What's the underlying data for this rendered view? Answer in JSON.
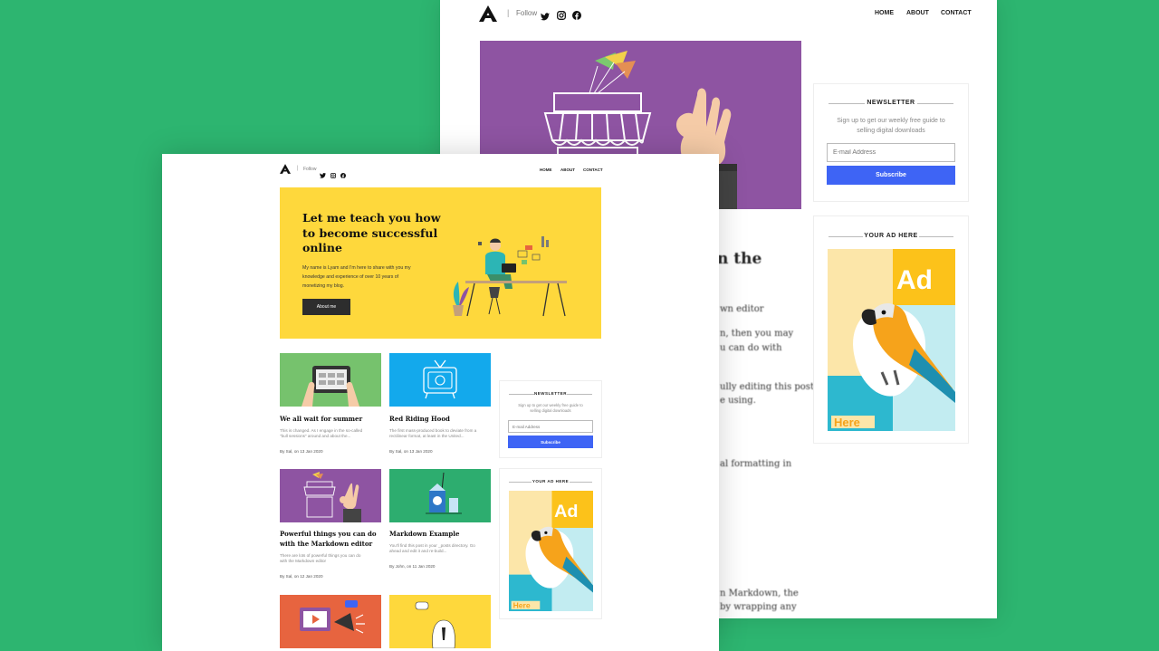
{
  "nav": {
    "follow": "Follow",
    "home": "HOME",
    "about": "ABOUT",
    "contact": "CONTACT"
  },
  "hero": {
    "title_l1": "Let me teach you how",
    "title_l2": "to become successful",
    "title_l3": "online",
    "text_l1": "My name is Lyam and I'm here to share with you my",
    "text_l2": "knowledge and experience of over 10 years of",
    "text_l3": "monetizing my blog.",
    "button": "About me"
  },
  "newsletter": {
    "title": "NEWSLETTER",
    "text_l1": "Sign up to get our weekly free guide to",
    "text_l2": "selling digital downloads",
    "placeholder": "E-mail Address",
    "button": "Subscribe"
  },
  "ad": {
    "title": "YOUR AD HERE",
    "word": "Ad",
    "here": "Here"
  },
  "posts": [
    {
      "title_l1": "We all wait for summer",
      "title_l2": "",
      "excerpt_l1": "This is changed. As I engage in the so-called",
      "excerpt_l2": "\"bull sessions\" around and about the...",
      "meta": "By Sal, on 13 Jan 2020"
    },
    {
      "title_l1": "Red Riding Hood",
      "title_l2": "",
      "excerpt_l1": "The first mass-produced book to deviate from a",
      "excerpt_l2": "rectilinear format, at least in the United...",
      "meta": "By Sal, on 13 Jan 2020"
    },
    {
      "title_l1": "Powerful things you can do",
      "title_l2": "with the Markdown editor",
      "excerpt_l1": "There are lots of powerful things you can do",
      "excerpt_l2": "with the Markdown editor",
      "meta": "By Sal, on 12 Jan 2020"
    },
    {
      "title_l1": "Markdown Example",
      "title_l2": "",
      "excerpt_l1": "You'll find this post in your _posts directory. Go",
      "excerpt_l2": "ahead and edit it and re-build...",
      "meta": "By John, on 11 Jan 2020"
    }
  ],
  "back_article": {
    "title_frag": "n the",
    "l1": "wn editor",
    "l2": "n, then you may",
    "l3": "u can do with",
    "l4": "ully editing this post",
    "l5": "e using.",
    "l6": "al formatting in",
    "l7": "n Markdown, the",
    "l8": "by wrapping any"
  },
  "colors": {
    "background": "#2db570",
    "hero": "#fed83c",
    "purple": "#8e54a2",
    "subscribe": "#3e64f5",
    "card_green": "#76c26d",
    "card_blue": "#13a9ec",
    "card_teal": "#2dad6f",
    "card_orange": "#e7643f",
    "card_yellow": "#fed83c"
  },
  "icons": [
    "logo-icon",
    "twitter-icon",
    "instagram-icon",
    "facebook-icon",
    "parrot-icon"
  ]
}
